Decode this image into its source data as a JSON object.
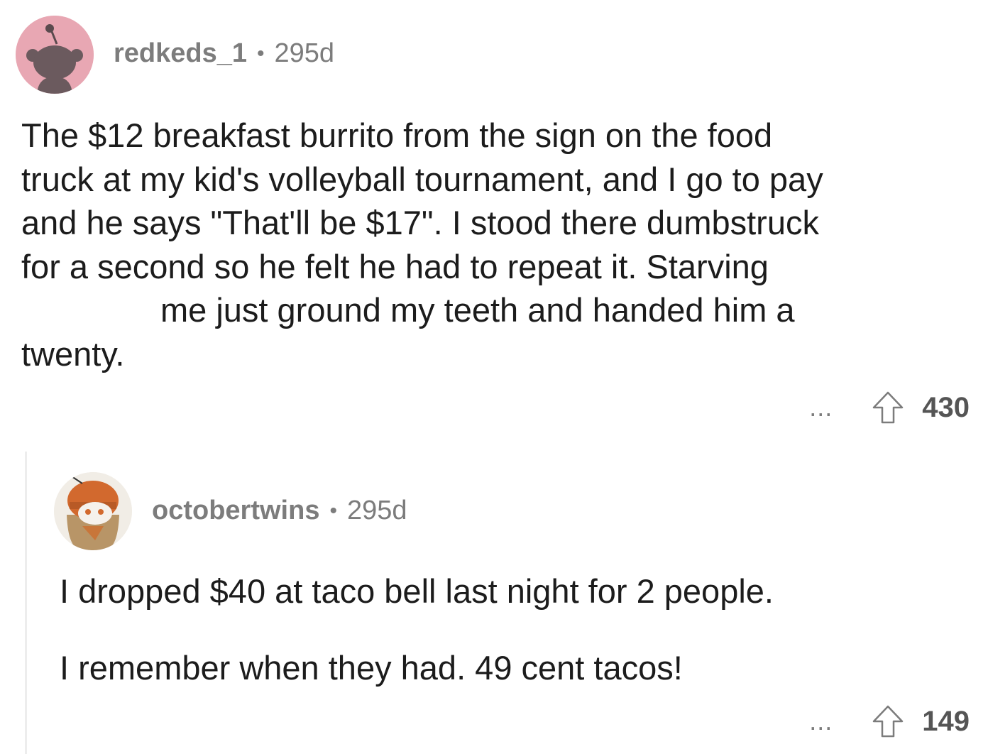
{
  "comments": [
    {
      "username": "redkeds_1",
      "separator": "•",
      "age": "295d",
      "body_lines": [
        "The $12 breakfast burrito from the sign on the food",
        "truck at my kid's volleyball tournament, and I go to pay",
        "and he says \"That'll be $17\". I stood there dumbstruck",
        "for a second so he felt he had to repeat it. Starving",
        "me just ground my teeth and handed him a",
        "twenty."
      ],
      "more": "...",
      "upvote_icon": "arrow-up-outline-icon",
      "score": "430",
      "avatar_color": "#e8a7b3"
    },
    {
      "username": "octobertwins",
      "separator": "•",
      "age": "295d",
      "paragraphs": [
        "I dropped $40 at taco bell last night for 2 people.",
        "I remember when they had. 49 cent tacos!"
      ],
      "more": "...",
      "upvote_icon": "arrow-up-outline-icon",
      "score": "149"
    }
  ],
  "colors": {
    "text": "#1c1c1c",
    "meta": "#7c7c7c",
    "score": "#555555",
    "thread_line": "#ededed"
  }
}
